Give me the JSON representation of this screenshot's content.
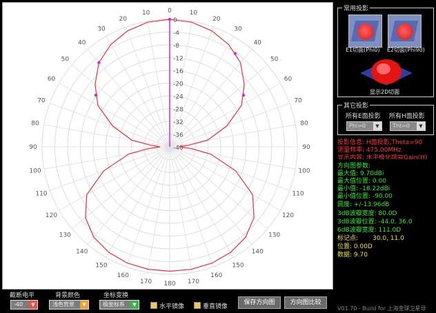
{
  "chart_data": {
    "type": "polar-line",
    "angle_ticks": [
      "0",
      "10",
      "20",
      "30",
      "40",
      "50",
      "60",
      "70",
      "80",
      "90",
      "100",
      "110",
      "120",
      "130",
      "140",
      "150",
      "160",
      "170",
      "180",
      "170",
      "160",
      "150",
      "140",
      "130",
      "120",
      "110",
      "100",
      "90",
      "80",
      "70",
      "60",
      "50",
      "40",
      "30",
      "20",
      "10"
    ],
    "radial_ticks": [
      "0",
      "-4",
      "-8",
      "-12",
      "-16",
      "-20",
      "-24",
      "-28",
      "-32",
      "-36",
      "-40"
    ],
    "r_range": [
      -40,
      0
    ],
    "series": [
      {
        "color": "#e8303a",
        "angles": [
          0,
          10,
          20,
          30,
          40,
          50,
          60,
          70,
          80,
          85,
          90,
          95,
          100,
          110,
          120,
          130,
          140,
          150,
          160,
          170,
          180,
          190,
          200,
          210,
          220,
          230,
          240,
          250,
          260,
          265,
          270,
          275,
          280,
          290,
          300,
          310,
          320,
          330,
          340,
          350
        ],
        "values": [
          0,
          -0.3,
          -1.3,
          -3.0,
          -5.5,
          -9.5,
          -14,
          -21,
          -28,
          -34,
          -37,
          -33,
          -27,
          -18,
          -10,
          -5.5,
          -3.0,
          -1.8,
          -1.2,
          -1.0,
          -1.0,
          -1.0,
          -1.2,
          -1.8,
          -3.0,
          -5.5,
          -10,
          -18,
          -27,
          -33,
          -37,
          -34,
          -28,
          -21,
          -14,
          -9.5,
          -5.5,
          -3.0,
          -1.3,
          -0.3
        ]
      }
    ],
    "markers": [
      0,
      35,
      55,
      305,
      320
    ],
    "beam_axis_angle": 0,
    "grid": true
  },
  "panel": {
    "common_projection_title": "常用投影",
    "thumb1_label": "E1切面(Phi0)",
    "thumb2_label": "E2切面(Phi90)",
    "show_2d_label": "显示2D切面",
    "other_projection_title": "其它投影",
    "all_e_label": "所有E面投影",
    "all_h_label": "所有H面投影",
    "phi_value": "Phi=0",
    "theta_value": "Tht=0"
  },
  "info": {
    "projection_info": "投影信息: H面投影,Theta=90",
    "freq": "测量频率: 475.00MHz",
    "display": "显示内容: 水平极化增益Gain(H)",
    "pattern_params": "方向图参数:",
    "max_value": "最大值: 9.70dBi",
    "max_pos": "最大值位置: 0.00",
    "min_value": "最小值: -18.22dBi",
    "min_pos": "最小值位置: -90.00",
    "roundness": "圆度: +/-13.96dB",
    "bw3": "3dB波瓣宽度: 80.0D",
    "bw3_pos": "3dB波瓣位置: -44.0, 36.0",
    "bw6": "6dB波瓣宽度: 111.0D",
    "marker_label": "标记点:",
    "marker_value": "30.0, 11.0",
    "position": "位置: 0.00D",
    "data": "数据: 9.70",
    "version": "V01.70 - Build for 上海金球卫星导"
  },
  "bottom": {
    "cutoff_label": "截断电平",
    "cutoff_value": "-40",
    "bg_color_label": "背景颜色",
    "bg_color_value": "浅色背景",
    "coord_label": "坐标变换",
    "coord_value": "极坐标系",
    "hmirror_label": "水平镜像",
    "vmirror_label": "垂直镜像",
    "save_button": "保存方向图",
    "compare_button": "方向图比较"
  },
  "colors": {
    "trace": "#e8303a",
    "marker": "#e020e0",
    "info_red": "#ff3b3b",
    "info_green": "#39e639"
  }
}
